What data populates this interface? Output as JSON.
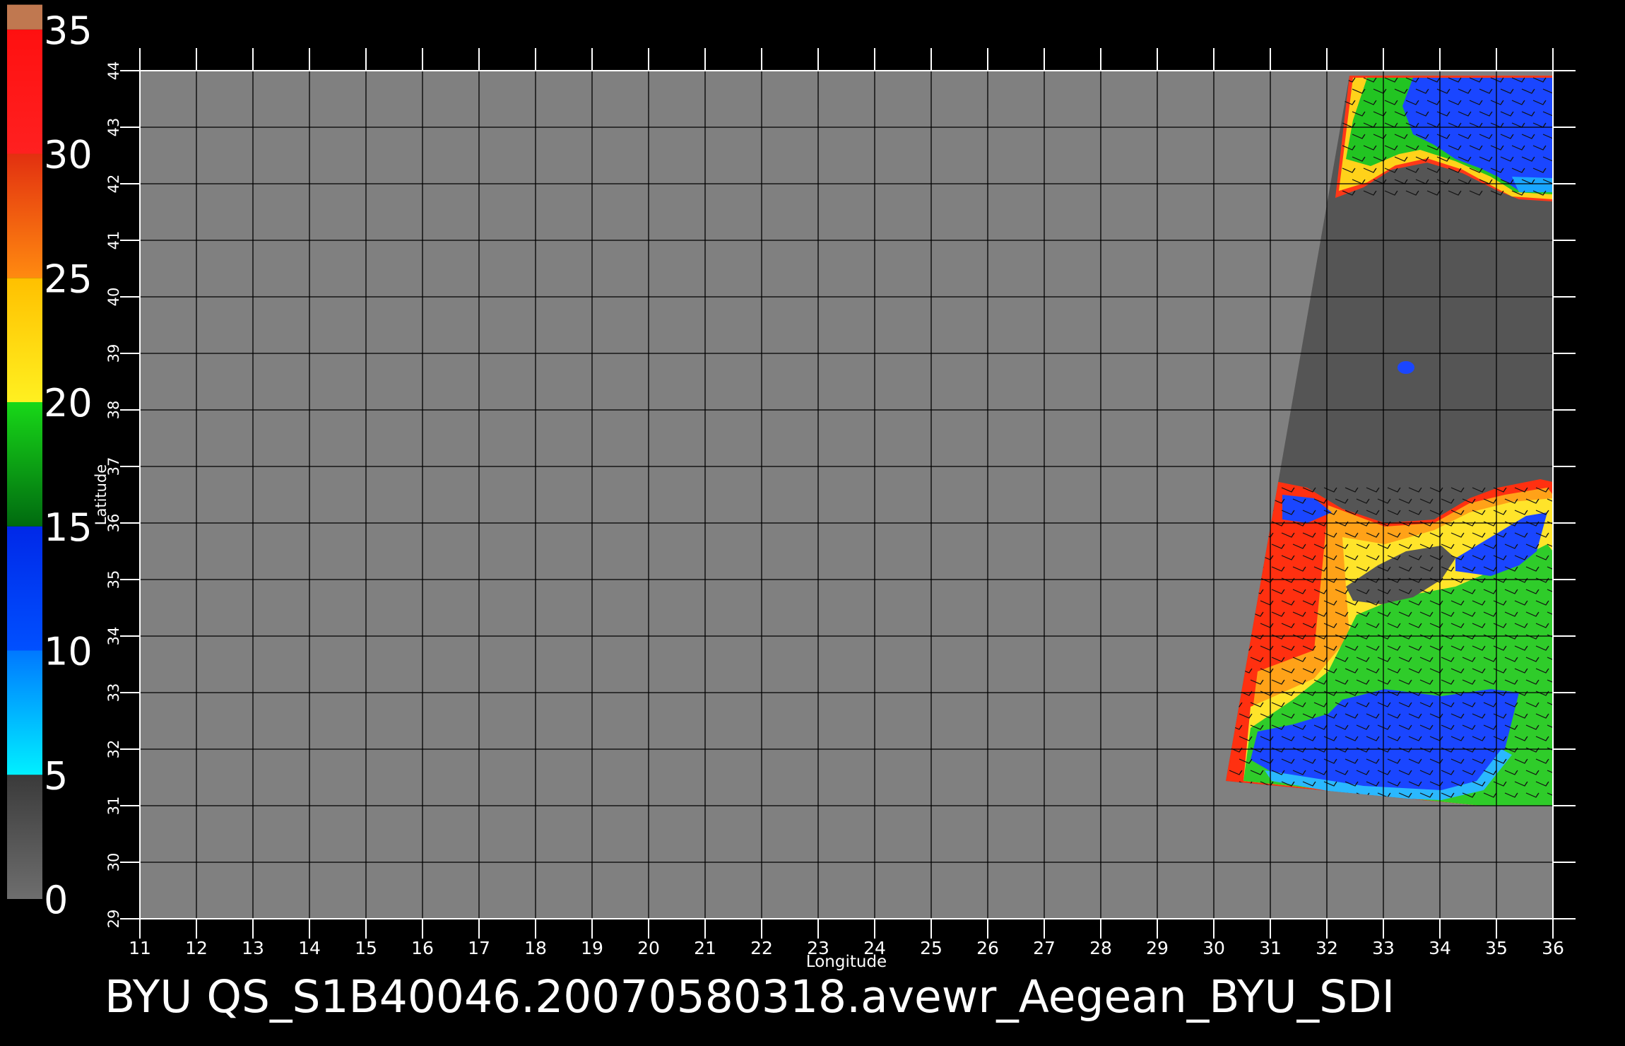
{
  "title": "BYU  QS_S1B40046.20070580318.avewr_Aegean_BYU_SDI",
  "colorbar": {
    "ticks": [
      "0",
      "5",
      "10",
      "15",
      "20",
      "25",
      "30",
      "35"
    ],
    "segments": [
      {
        "from": 0,
        "to": 5,
        "colors": [
          "#6e6e6e",
          "#3a3a3a"
        ]
      },
      {
        "from": 5,
        "to": 10,
        "colors": [
          "#00f0ff",
          "#0078ff"
        ]
      },
      {
        "from": 10,
        "to": 15,
        "colors": [
          "#0050ff",
          "#0028e8"
        ]
      },
      {
        "from": 15,
        "to": 20,
        "colors": [
          "#006a10",
          "#18d818"
        ]
      },
      {
        "from": 20,
        "to": 25,
        "colors": [
          "#fff020",
          "#ffc000"
        ]
      },
      {
        "from": 25,
        "to": 30,
        "colors": [
          "#ff8a10",
          "#e23010"
        ]
      },
      {
        "from": 30,
        "to": 35,
        "colors": [
          "#ff2020",
          "#ff1010"
        ]
      },
      {
        "from": 35,
        "to": 36,
        "colors": [
          "#c07850",
          "#c07850"
        ]
      }
    ]
  },
  "map": {
    "xlabel": "Longitude",
    "ylabel": "Latitude",
    "lon_ticks": [
      "11",
      "12",
      "13",
      "14",
      "15",
      "16",
      "17",
      "18",
      "19",
      "20",
      "21",
      "22",
      "23",
      "24",
      "25",
      "26",
      "27",
      "28",
      "29",
      "30",
      "31",
      "32",
      "33",
      "34",
      "35",
      "36"
    ],
    "lat_ticks": [
      "29",
      "30",
      "31",
      "32",
      "33",
      "34",
      "35",
      "36",
      "37",
      "38",
      "39",
      "40",
      "41",
      "42",
      "43",
      "44"
    ],
    "lon_range": [
      11,
      36
    ],
    "lat_range": [
      29,
      44
    ],
    "background_color": "#808080",
    "grid_color": "#000000",
    "swath_nodata_color": "#555555"
  }
}
